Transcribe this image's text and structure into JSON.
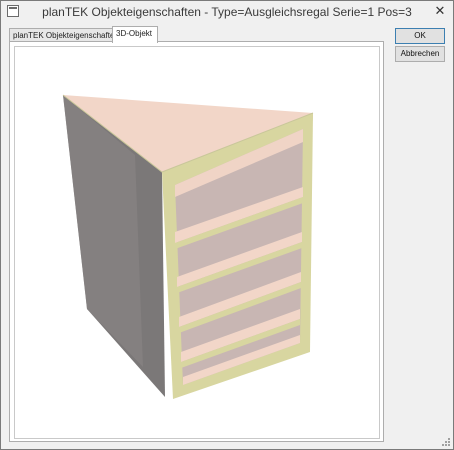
{
  "window": {
    "title": "planTEK Objekteigenschaften - Type=Ausgleichsregal  Serie=1  Pos=3",
    "close_glyph": "✕"
  },
  "tabs": [
    {
      "label": "planTEK Objekteigenschaften",
      "active": false
    },
    {
      "label": "3D-Objekt",
      "active": true
    }
  ],
  "buttons": {
    "ok_label": "OK",
    "cancel_label": "Abbrechen"
  },
  "icons": {
    "app": "app-icon",
    "close": "close-icon",
    "resize": "resize-grip-icon"
  },
  "colors": {
    "shelf_surface": "#f2d6c8",
    "frame_edge": "#d8d6a0",
    "side_panel": "#7d7a7a",
    "back_panel": "#b8a8a6"
  }
}
